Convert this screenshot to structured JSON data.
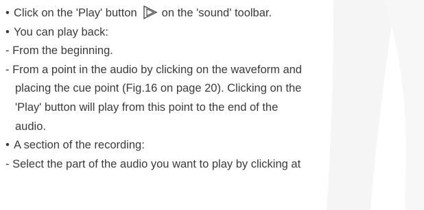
{
  "instructions": {
    "line1_before_icon": "Click on the 'Play' button",
    "line1_after_icon": "on the 'sound' toolbar.",
    "line2": "You can play back:",
    "line3": "- From the beginning.",
    "line4": "- From a point in the audio by clicking on the waveform and",
    "line5": "placing the cue point (Fig.16 on page 20). Clicking on the",
    "line6": "'Play' button will play from this point to the end of the",
    "line7": "audio.",
    "line8": "A section of the recording:",
    "line9": "- Select the part of the audio you want to play by clicking at"
  },
  "icons": {
    "bullet": "•",
    "play": "play-icon"
  },
  "colors": {
    "text": "#3a3a3a",
    "watermark": "#f4f4f4"
  }
}
